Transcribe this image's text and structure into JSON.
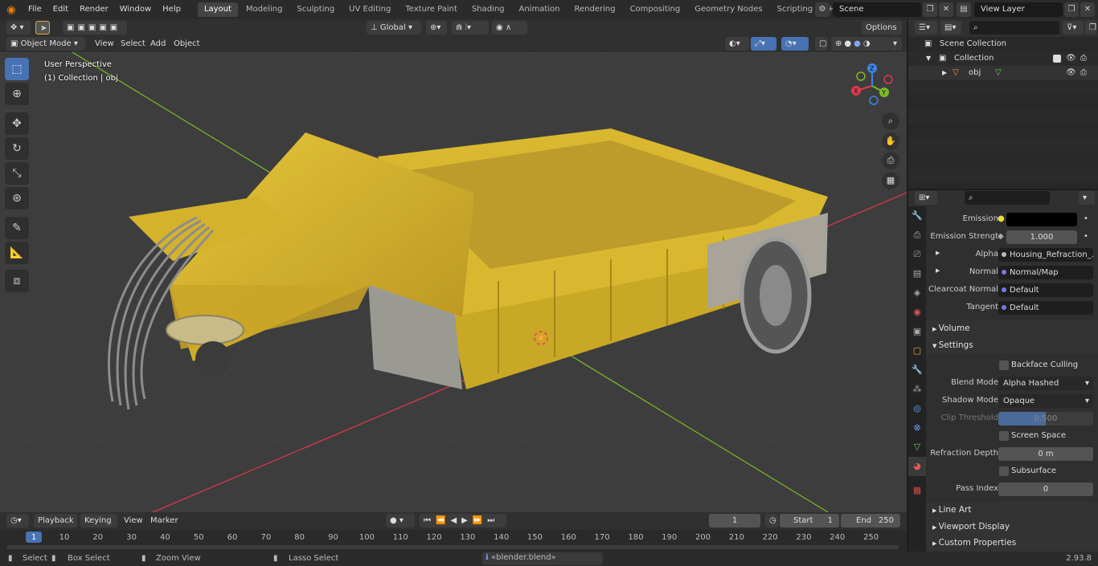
{
  "menubar": {
    "items": [
      "File",
      "Edit",
      "Render",
      "Window",
      "Help"
    ],
    "workspaces": [
      "Layout",
      "Modeling",
      "Sculpting",
      "UV Editing",
      "Texture Paint",
      "Shading",
      "Animation",
      "Rendering",
      "Compositing",
      "Geometry Nodes",
      "Scripting"
    ],
    "active_workspace": "Layout",
    "add_workspace": "+",
    "scene_name": "Scene",
    "view_layer_name": "View Layer"
  },
  "viewport_header": {
    "transform_orientation": "Global",
    "options_label": "Options",
    "mode": "Object Mode",
    "menus": [
      "View",
      "Select",
      "Add",
      "Object"
    ]
  },
  "viewport": {
    "perspective_label": "User Perspective",
    "collection_label": "(1) Collection | obj",
    "gizmo_axes": [
      "X",
      "Y",
      "Z"
    ]
  },
  "timeline": {
    "menus": [
      "Playback",
      "Keying",
      "View",
      "Marker"
    ],
    "current_frame": "1",
    "start_label": "Start",
    "start_value": "1",
    "end_label": "End",
    "end_value": "250",
    "ruler": [
      "1",
      "10",
      "20",
      "30",
      "40",
      "50",
      "60",
      "70",
      "80",
      "90",
      "100",
      "110",
      "120",
      "130",
      "140",
      "150",
      "160",
      "170",
      "180",
      "190",
      "200",
      "210",
      "220",
      "230",
      "240",
      "250"
    ]
  },
  "statusbar": {
    "select": "Select",
    "box_select": "Box Select",
    "zoom_view": "Zoom View",
    "lasso_select": "Lasso Select",
    "message": "«blender.blend» сохранено",
    "version": "2.93.8"
  },
  "outliner": {
    "scene_collection": "Scene Collection",
    "collection": "Collection",
    "object": "obj"
  },
  "properties": {
    "emission_label": "Emission",
    "emission_strength_label": "Emission Strengt",
    "emission_strength_value": "1.000",
    "alpha_label": "Alpha",
    "alpha_value": "Housing_Refraction_...",
    "normal_label": "Normal",
    "normal_value": "Normal/Map",
    "clearcoat_normal_label": "Clearcoat Normal",
    "clearcoat_normal_value": "Default",
    "tangent_label": "Tangent",
    "tangent_value": "Default",
    "volume_section": "Volume",
    "settings_section": "Settings",
    "backface_culling": "Backface Culling",
    "blend_mode_label": "Blend Mode",
    "blend_mode_value": "Alpha Hashed",
    "shadow_mode_label": "Shadow Mode",
    "shadow_mode_value": "Opaque",
    "clip_threshold_label": "Clip Threshold",
    "clip_threshold_value": "0.500",
    "clip_threshold_fraction": 0.5,
    "screen_space_refraction": "Screen Space Refraction",
    "refraction_depth_label": "Refraction Depth",
    "refraction_depth_value": "0 m",
    "subsurface_translucency": "Subsurface Translucency",
    "pass_index_label": "Pass Index",
    "pass_index_value": "0",
    "line_art_section": "Line Art",
    "viewport_display_section": "Viewport Display",
    "custom_properties_section": "Custom Properties"
  },
  "colors": {
    "accent_blue": "#4772b3",
    "axis_x": "#e0394d",
    "axis_y": "#7cba27",
    "axis_z": "#3c86e6",
    "model_yellow": "#d8b62a"
  }
}
